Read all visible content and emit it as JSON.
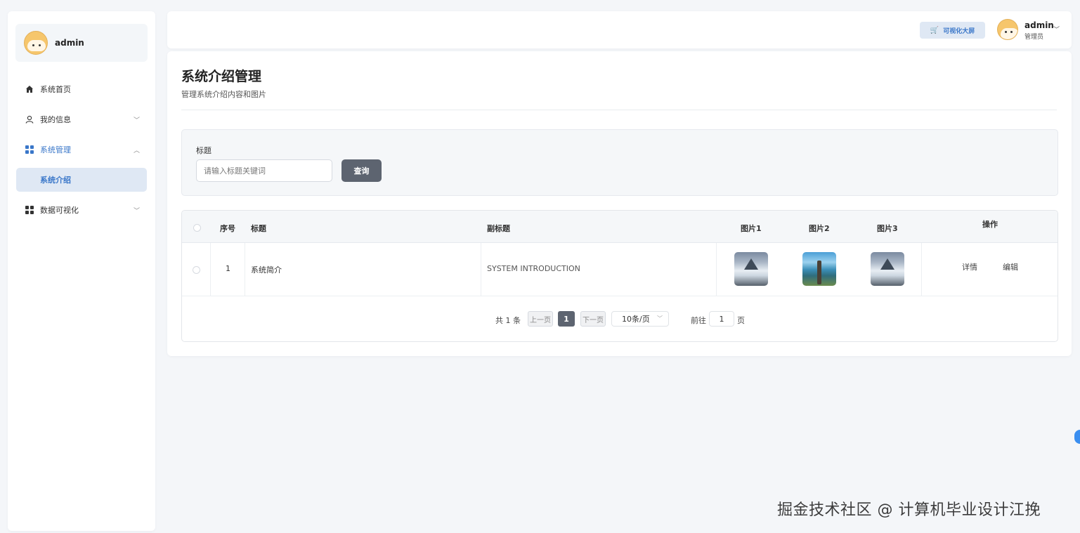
{
  "sidebar": {
    "user_name": "admin",
    "menu": [
      {
        "label": "系统首页",
        "icon": "home-icon"
      },
      {
        "label": "我的信息",
        "icon": "user-icon"
      },
      {
        "label": "系统管理",
        "icon": "grid-icon",
        "active": true
      },
      {
        "label": "数据可视化",
        "icon": "grid-icon"
      }
    ],
    "submenu_active": "系统介绍"
  },
  "header": {
    "viz_button_label": "可视化大屏",
    "user_name": "admin",
    "user_role": "管理员"
  },
  "page": {
    "title": "系统介绍管理",
    "subtitle": "管理系统介绍内容和图片"
  },
  "search": {
    "label": "标题",
    "placeholder": "请输入标题关键词",
    "button_label": "查询"
  },
  "table": {
    "columns": [
      "序号",
      "标题",
      "副标题",
      "图片1",
      "图片2",
      "图片3",
      "操作"
    ],
    "rows": [
      {
        "index": "1",
        "title": "系统简介",
        "subtitle": "SYSTEM INTRODUCTION",
        "actions": [
          "详情",
          "编辑"
        ]
      }
    ]
  },
  "pagination": {
    "total": "共 1 条",
    "prev": "上一页",
    "current": "1",
    "next": "下一页",
    "page_size": "10条/页",
    "goto_prefix": "前往",
    "goto_value": "1",
    "goto_suffix": "页"
  },
  "watermark": "掘金技术社区 @ 计算机毕业设计江挽",
  "colors": {
    "accent": "#3a77c9",
    "button_dark": "#5d6470"
  }
}
